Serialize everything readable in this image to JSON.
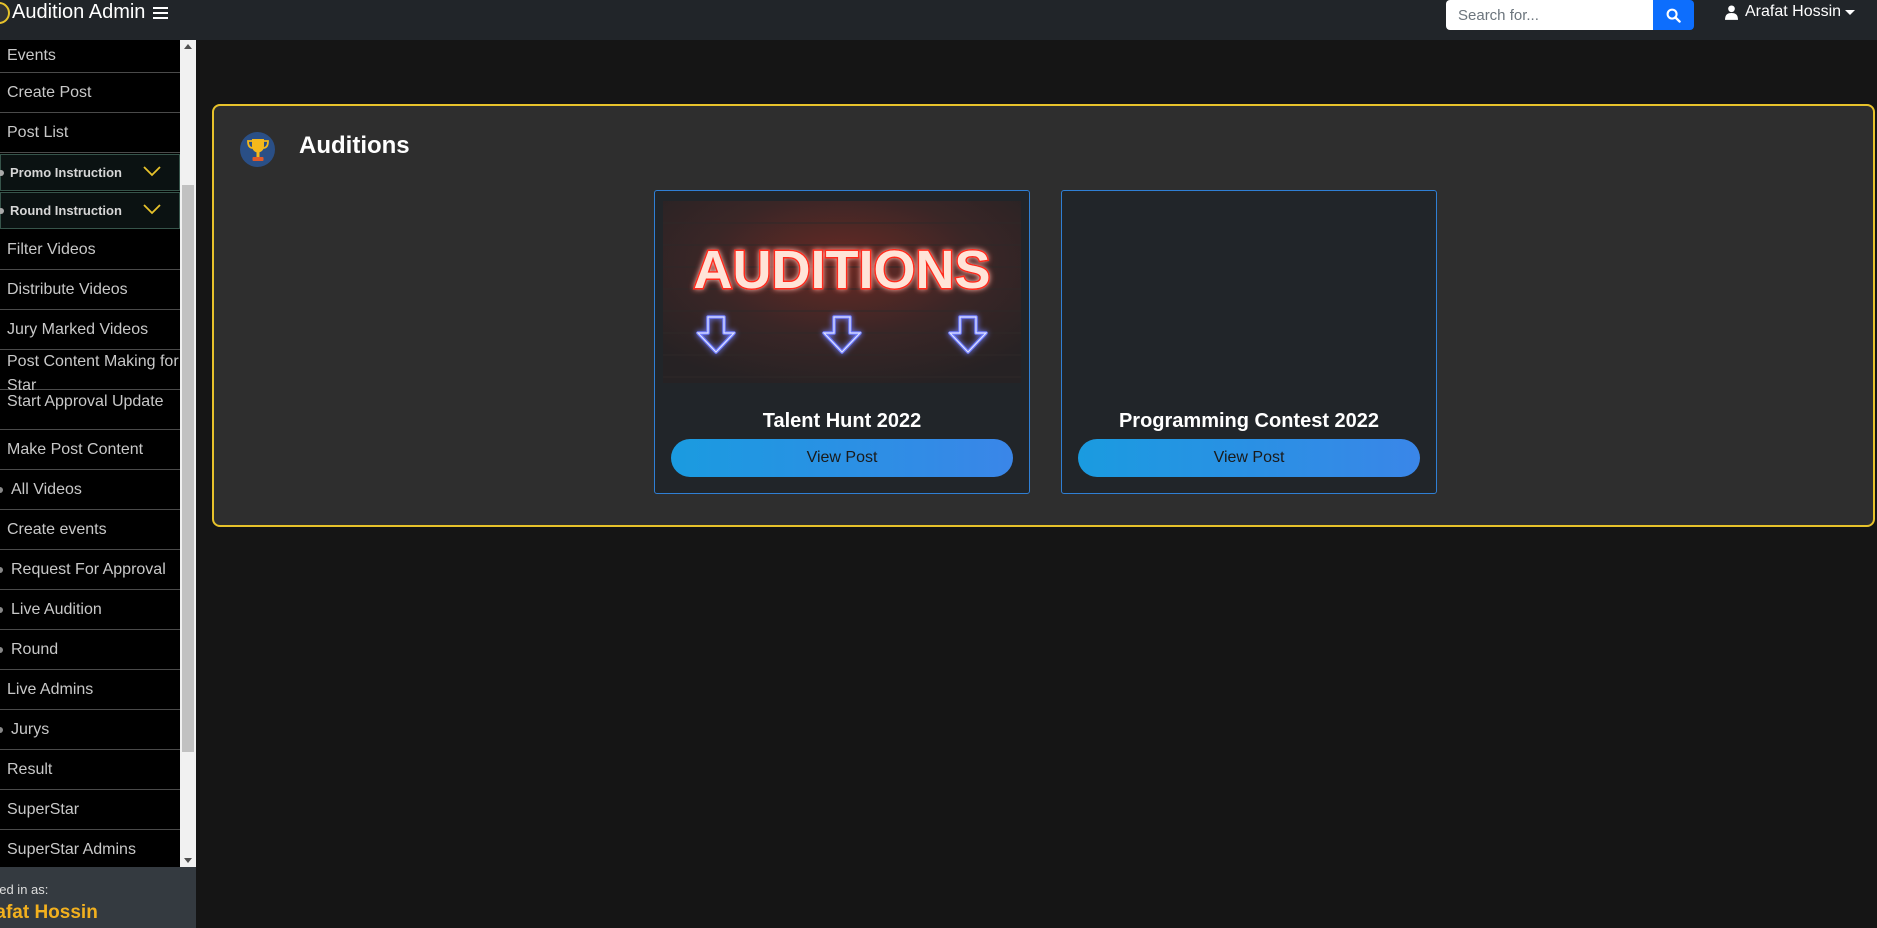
{
  "header": {
    "brand": "Audition Admin",
    "search_placeholder": "Search for...",
    "user_name": "Arafat Hossin"
  },
  "sidebar": {
    "items": [
      {
        "label": "Events"
      },
      {
        "label": "Create Post"
      },
      {
        "label": "Post List"
      },
      {
        "label": "Promo Instruction"
      },
      {
        "label": "Round Instruction"
      },
      {
        "label": "Filter Videos"
      },
      {
        "label": "Distribute Videos"
      },
      {
        "label": "Jury Marked Videos"
      },
      {
        "label": "Post Content Making for Star"
      },
      {
        "label": "Start Approval Update"
      },
      {
        "label": "Make Post Content"
      },
      {
        "label": "All Videos"
      },
      {
        "label": "Create events"
      },
      {
        "label": "Request For Approval"
      },
      {
        "label": "Live Audition"
      },
      {
        "label": "Round"
      },
      {
        "label": "Live Admins"
      },
      {
        "label": "Jurys"
      },
      {
        "label": "Result"
      },
      {
        "label": "SuperStar"
      },
      {
        "label": "SuperStar Admins"
      }
    ],
    "logged_in_label": "ged in as:",
    "logged_in_name": "rafat Hossin"
  },
  "main": {
    "title": "Auditions",
    "cards": [
      {
        "title": "Talent Hunt 2022",
        "image_text": "AUDITIONS",
        "button": "View Post"
      },
      {
        "title": "Programming Contest 2022",
        "button": "View Post"
      }
    ]
  },
  "colors": {
    "accent_yellow": "#e7c22b",
    "primary_blue": "#0d6efd",
    "card_border": "#2f7fd4"
  }
}
